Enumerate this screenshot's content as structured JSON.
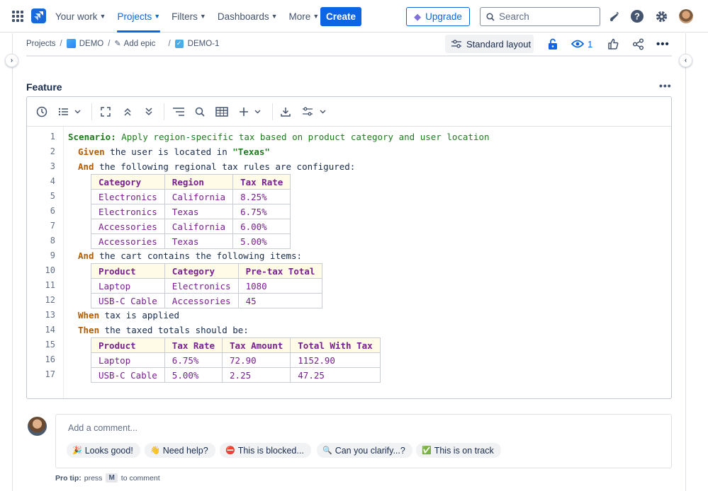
{
  "nav": {
    "items": [
      {
        "label": "Your work"
      },
      {
        "label": "Projects"
      },
      {
        "label": "Filters"
      },
      {
        "label": "Dashboards"
      },
      {
        "label": "More"
      }
    ],
    "create": "Create",
    "upgrade": "Upgrade",
    "search_placeholder": "Search"
  },
  "breadcrumb": {
    "projects": "Projects",
    "project": "DEMO",
    "epic": "Add epic",
    "issue": "DEMO-1"
  },
  "header": {
    "layout": "Standard layout",
    "watchers": "1"
  },
  "feature": {
    "title": "Feature",
    "line_numbers": [
      "1",
      "2",
      "3",
      "4",
      "5",
      "6",
      "7",
      "8",
      "9",
      "10",
      "11",
      "12",
      "13",
      "14",
      "15",
      "16",
      "17"
    ],
    "lines": {
      "l1": {
        "kw": "Scenario:",
        "text": " Apply region-specific tax based on product category and user location"
      },
      "l2": {
        "kw": "Given",
        "text": " the user is located in ",
        "str": "\"Texas\""
      },
      "l3": {
        "kw": "And",
        "text": " the following regional tax rules are configured:"
      },
      "l9": {
        "kw": "And",
        "text": " the cart contains the following items:"
      },
      "l13": {
        "kw": "When",
        "text": " tax is applied"
      },
      "l14": {
        "kw": "Then",
        "text": " the taxed totals should be:"
      }
    },
    "table1": {
      "headers": [
        "Category",
        "Region",
        "Tax Rate"
      ],
      "rows": [
        [
          "Electronics",
          "California",
          "8.25%"
        ],
        [
          "Electronics",
          "Texas",
          "6.75%"
        ],
        [
          "Accessories",
          "California",
          "6.00%"
        ],
        [
          "Accessories",
          "Texas",
          "5.00%"
        ]
      ]
    },
    "table2": {
      "headers": [
        "Product",
        "Category",
        "Pre-tax Total"
      ],
      "rows": [
        [
          "Laptop",
          "Electronics",
          "1080"
        ],
        [
          "USB-C Cable",
          "Accessories",
          "45"
        ]
      ]
    },
    "table3": {
      "headers": [
        "Product",
        "Tax Rate",
        "Tax Amount",
        "Total With Tax"
      ],
      "rows": [
        [
          "Laptop",
          "6.75%",
          "72.90",
          "1152.90"
        ],
        [
          "USB-C Cable",
          "5.00%",
          "2.25",
          "47.25"
        ]
      ]
    }
  },
  "comment": {
    "placeholder": "Add a comment...",
    "chips": [
      {
        "emoji": "🎉",
        "label": "Looks good!"
      },
      {
        "emoji": "👋",
        "label": "Need help?"
      },
      {
        "emoji": "⛔",
        "label": "This is blocked..."
      },
      {
        "emoji": "🔍",
        "label": "Can you clarify...?"
      },
      {
        "emoji": "✅",
        "label": "This is on track"
      }
    ],
    "pro_tip_label": "Pro tip:",
    "pro_tip_press": "press",
    "pro_tip_key": "M",
    "pro_tip_suffix": "to comment"
  }
}
